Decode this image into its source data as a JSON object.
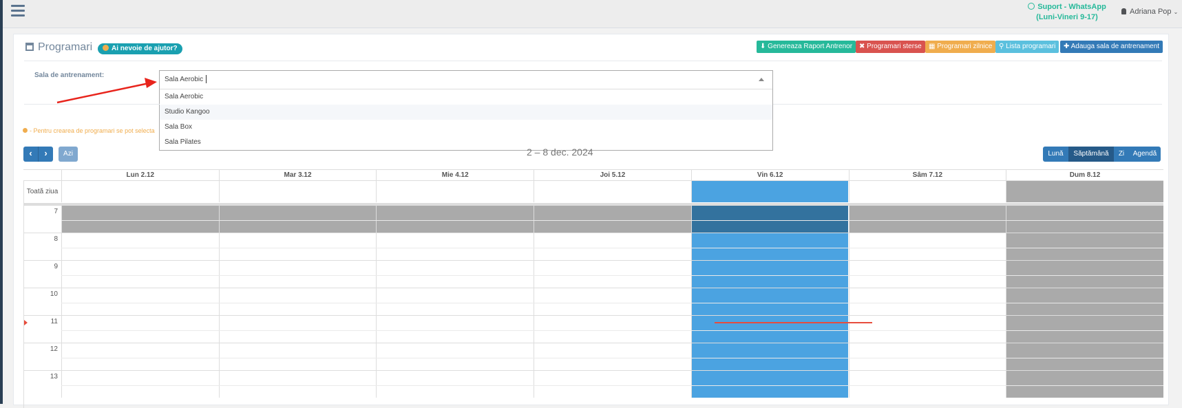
{
  "topbar": {
    "support_line1": "Suport - WhatsApp",
    "support_line2": "(Luni-Vineri 9-17)",
    "user_name": "Adriana Pop"
  },
  "page": {
    "title": "Programari",
    "help_label": "Ai nevoie de ajutor?"
  },
  "toolbar": {
    "buttons": [
      {
        "label": "Genereaza Raport Antrenor",
        "color": "#26b99a"
      },
      {
        "label": "Programari sterse",
        "color": "#d9534f"
      },
      {
        "label": "Programari zilnice",
        "color": "#f0ad4e"
      },
      {
        "label": "Lista programari",
        "color": "#5bc0de"
      },
      {
        "label": "Adauga sala de antrenament",
        "color": "#337ab7"
      }
    ]
  },
  "form": {
    "sala_label": "Sala de antrenament:",
    "sala_value": "Sala Aerobic",
    "options": [
      "Sala Aerobic",
      "Studio Kangoo",
      "Sala Box",
      "Sala Pilates"
    ],
    "highlighted_option": "Studio Kangoo"
  },
  "notice": "- Pentru crearea de programari se pot selecta",
  "calendar": {
    "today_label": "Azi",
    "range": "2 – 8 dec. 2024",
    "views": [
      "Lună",
      "Săptămână",
      "Zi",
      "Agendă"
    ],
    "active_view": "Săptămână",
    "allday_label": "Toată ziua",
    "days": [
      "Lun 2.12",
      "Mar 3.12",
      "Mie 4.12",
      "Joi 5.12",
      "Vin 6.12",
      "Sâm 7.12",
      "Dum 8.12"
    ],
    "today_index": 4,
    "hours": [
      "7",
      "8",
      "9",
      "10",
      "11",
      "12",
      "13"
    ],
    "colors": {
      "today": "#4ba3e1",
      "today_dark": "#33729e",
      "closed": "#aaaaaa",
      "now_line": "#e74c3c"
    }
  }
}
